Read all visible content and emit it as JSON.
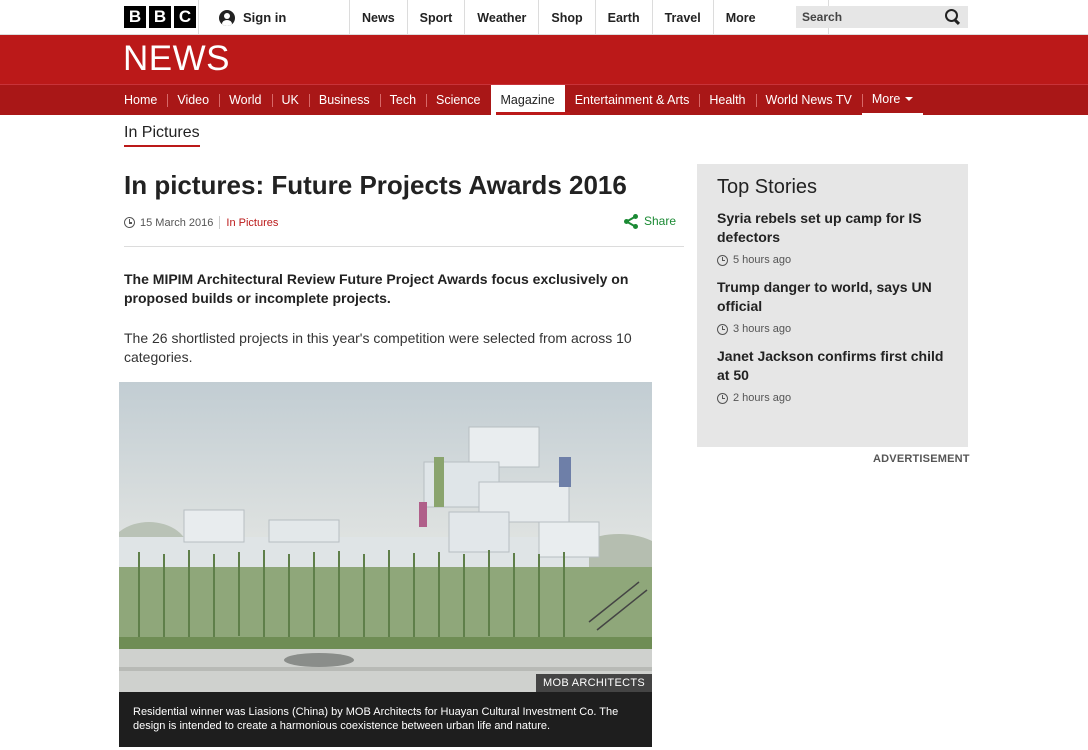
{
  "global": {
    "logo_letters": [
      "B",
      "B",
      "C"
    ],
    "signin_label": "Sign in",
    "nav": [
      "News",
      "Sport",
      "Weather",
      "Shop",
      "Earth",
      "Travel"
    ],
    "more_label": "More",
    "search_label": "Search"
  },
  "masthead": {
    "title": "NEWS",
    "nav": [
      "Home",
      "Video",
      "World",
      "UK",
      "Business",
      "Tech",
      "Science",
      "Magazine",
      "Entertainment & Arts",
      "Health",
      "World News TV"
    ],
    "active_item": "Magazine",
    "more_label": "More",
    "brand_color": "#bb1919"
  },
  "section_label": "In Pictures",
  "article": {
    "headline": "In pictures: Future Projects Awards 2016",
    "date": "15 March 2016",
    "section_link": "In Pictures",
    "share_label": "Share",
    "intro": "The MIPIM Architectural Review Future Project Awards focus exclusively on proposed builds or incomplete projects.",
    "body": "The 26 shortlisted projects in this year's competition were selected from across 10 categories.",
    "image_credit": "MOB ARCHITECTS",
    "image_caption": "Residential winner was Liasions (China) by MOB Architects for Huayan Cultural Investment Co. The design is intended to create a harmonious coexistence between urban life and nature."
  },
  "top_stories": {
    "title": "Top Stories",
    "items": [
      {
        "headline": "Syria rebels set up camp for IS defectors",
        "time": "5 hours ago"
      },
      {
        "headline": "Trump danger to world, says UN official",
        "time": "3 hours ago"
      },
      {
        "headline": "Janet Jackson confirms first child at 50",
        "time": "2 hours ago"
      }
    ]
  },
  "advertisement_label": "ADVERTISEMENT"
}
